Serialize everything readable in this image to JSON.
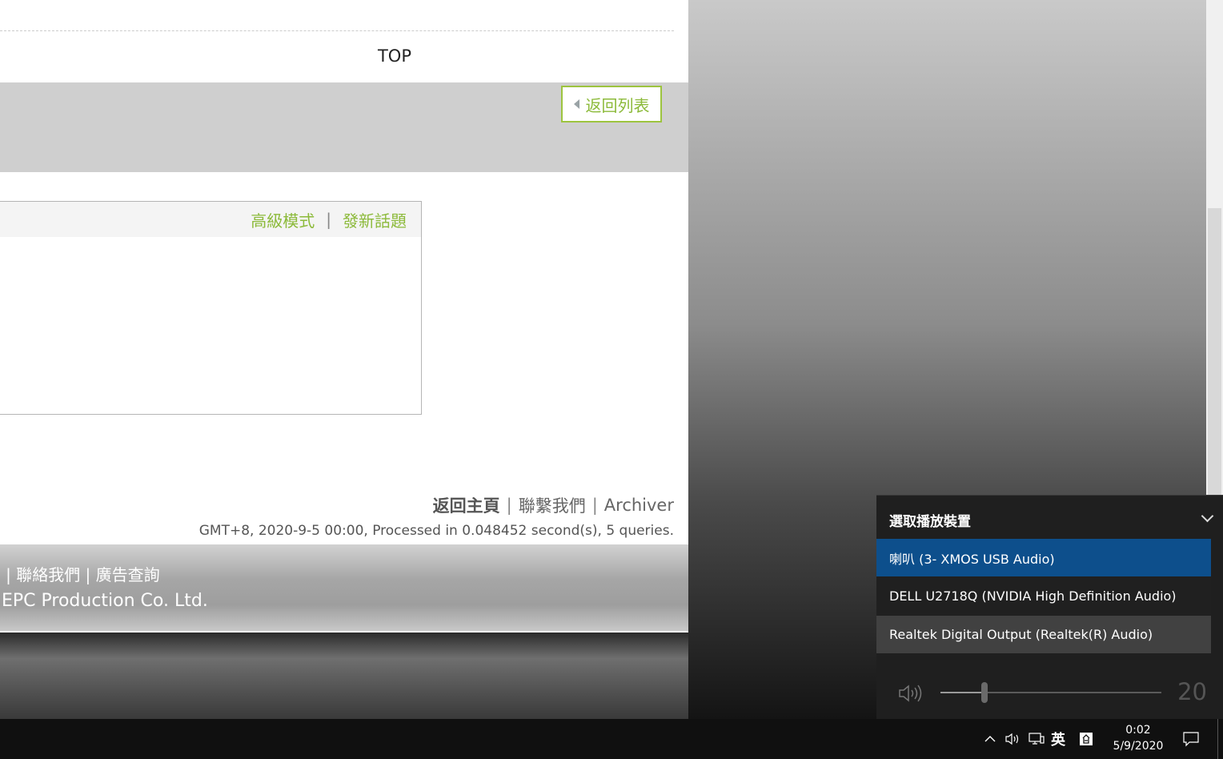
{
  "page": {
    "top_link": "TOP",
    "back_button": "返回列表",
    "reply_links": {
      "advanced": "高級模式",
      "separator": "|",
      "new_topic": "發新話題"
    },
    "footer_links": {
      "home": "返回主頁",
      "contact": "聯繫我們",
      "archiver": "Archiver",
      "separator": "|"
    },
    "footer_info": "GMT+8, 2020-9-5 00:00, Processed in 0.048452 second(s), 5 queries.",
    "site_footer_line1": "¦ | 聯絡我們 | 廣告查詢",
    "site_footer_line2": "EPC Production Co. Ltd."
  },
  "audio_flyout": {
    "title": "選取播放裝置",
    "devices": [
      {
        "label": "喇叭 (3- XMOS USB Audio)",
        "selected": true
      },
      {
        "label": "DELL U2718Q (NVIDIA High Definition Audio)",
        "selected": false
      },
      {
        "label": "Realtek Digital Output (Realtek(R) Audio)",
        "selected": false
      }
    ],
    "volume": "20",
    "volume_fraction": 0.2
  },
  "taskbar": {
    "ime": "英",
    "time": "0:02",
    "date": "5/9/2020"
  },
  "colors": {
    "accent_green": "#8cba3a",
    "selected_device": "#0d4f8c"
  }
}
